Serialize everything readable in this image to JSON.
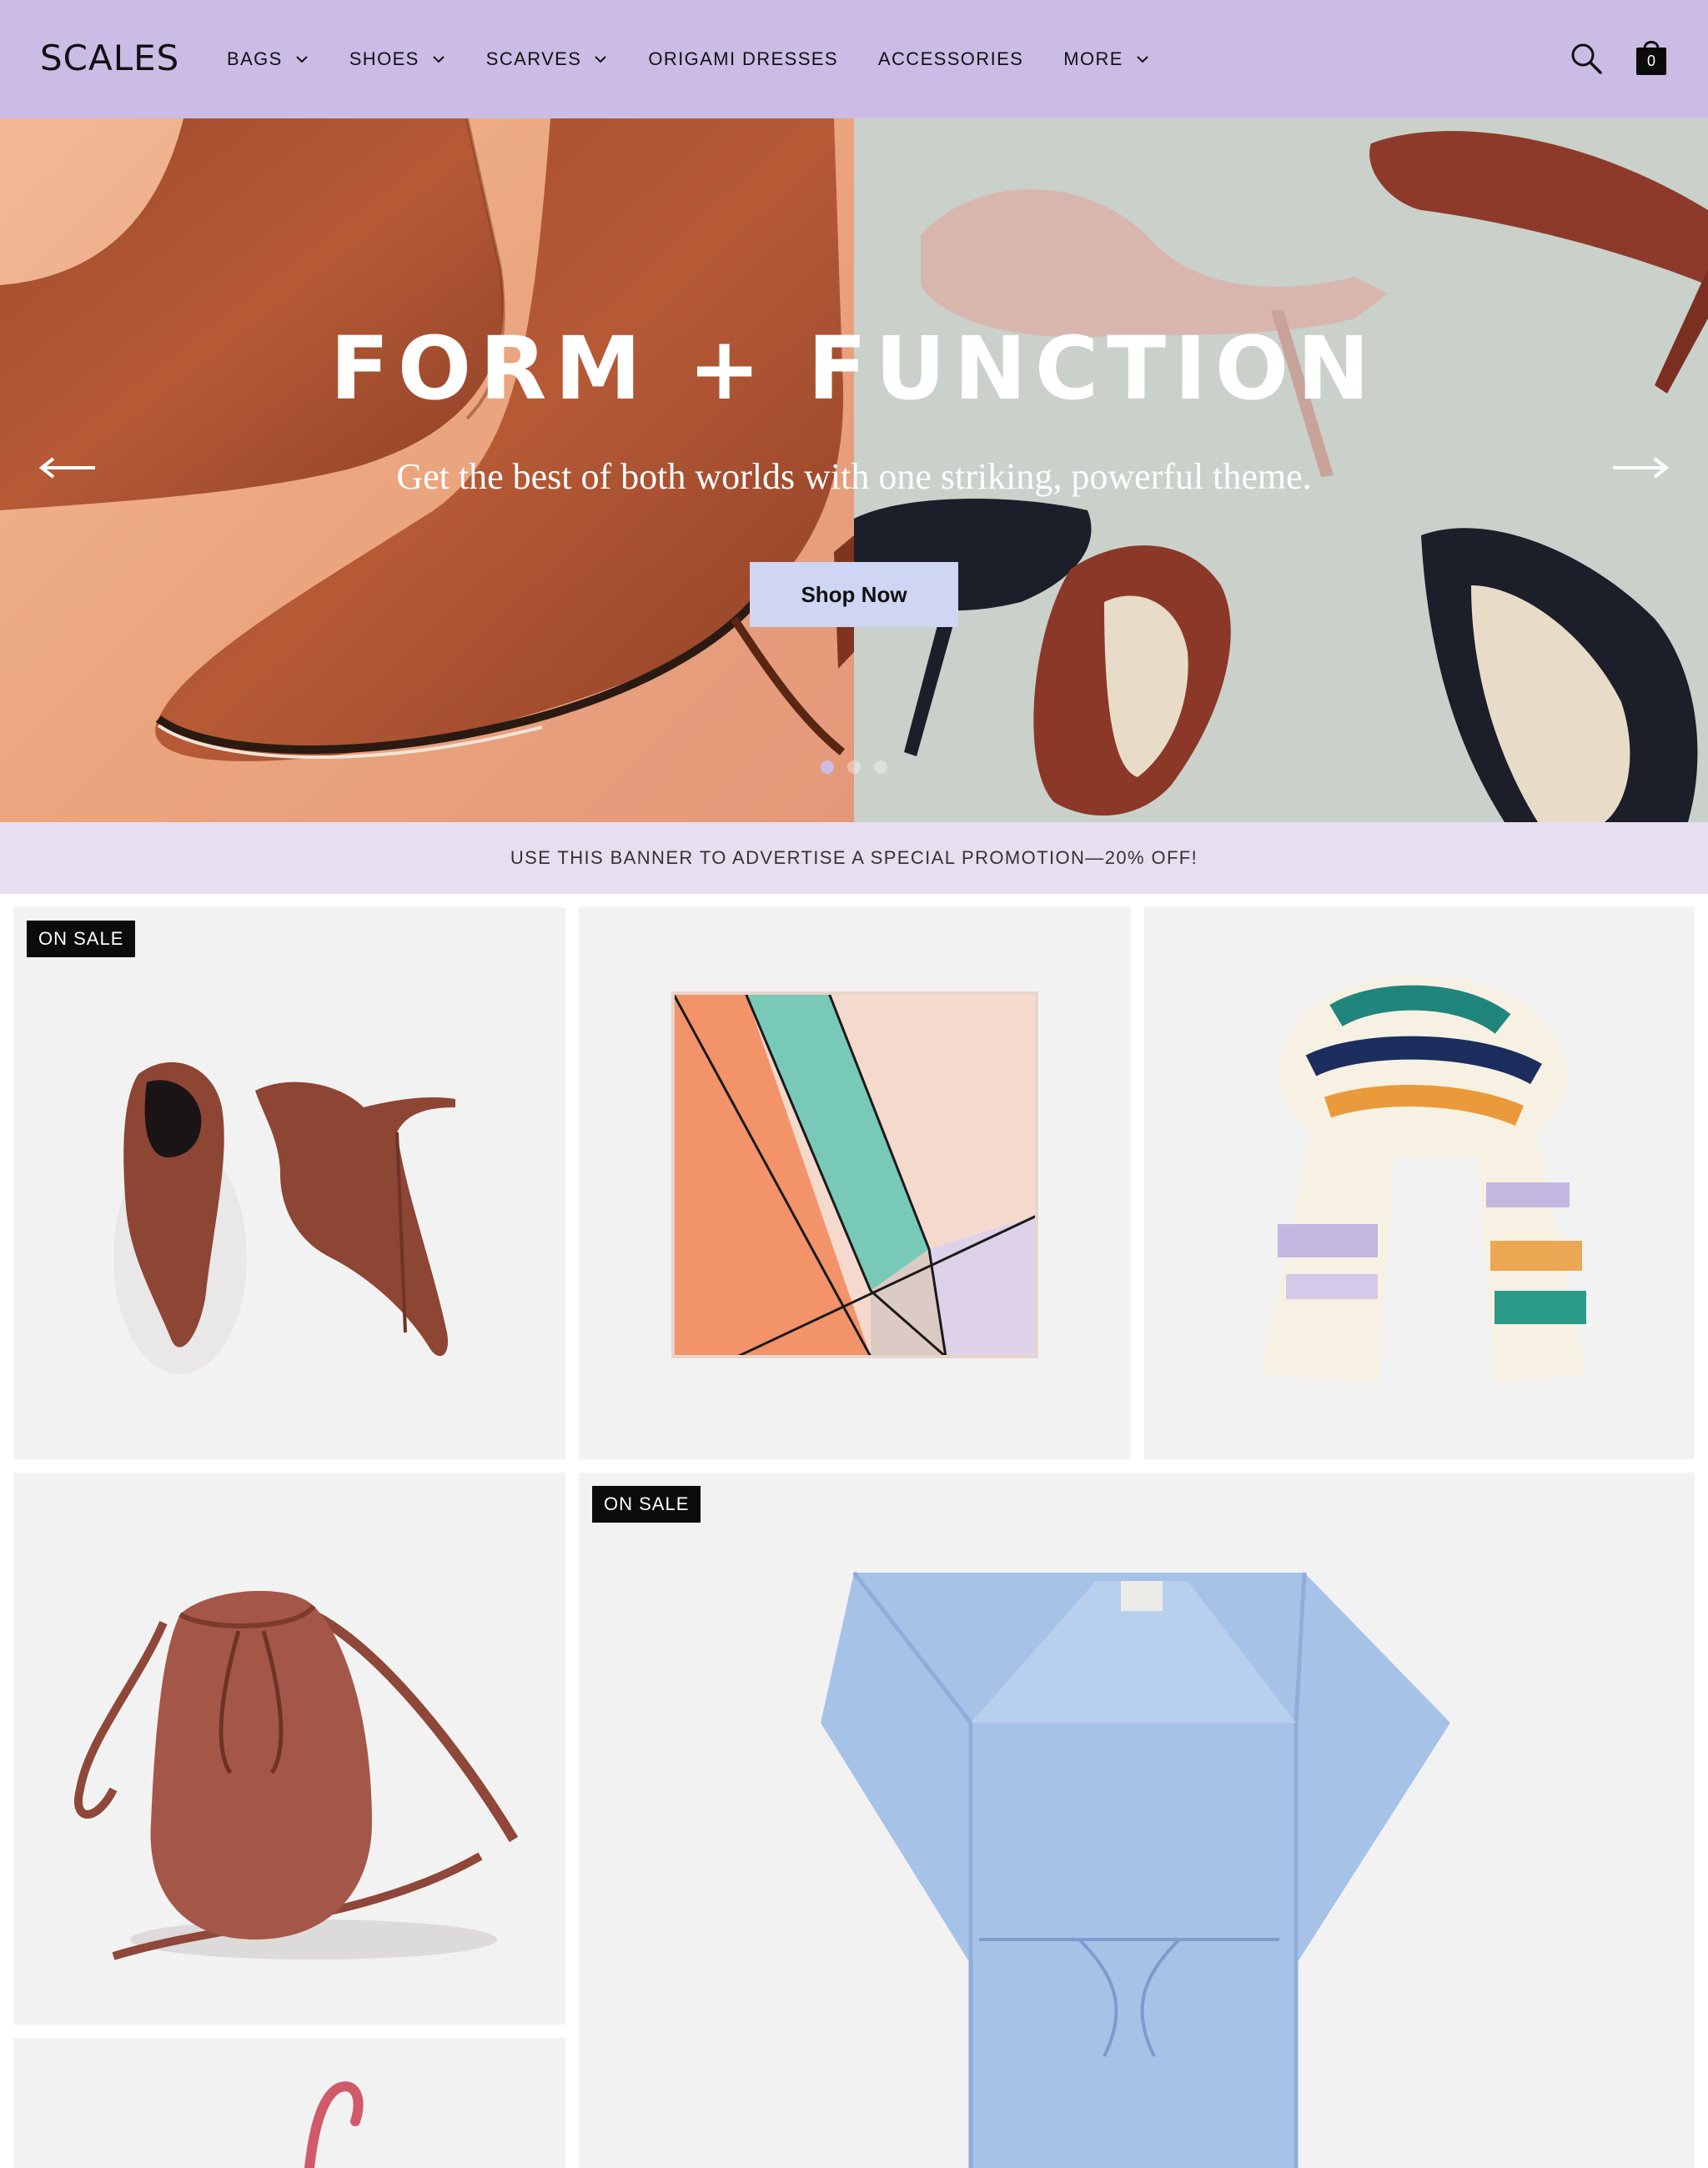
{
  "header": {
    "logo": "SCALES",
    "nav": [
      {
        "label": "BAGS",
        "has_dropdown": true
      },
      {
        "label": "SHOES",
        "has_dropdown": true
      },
      {
        "label": "SCARVES",
        "has_dropdown": true
      },
      {
        "label": "ORIGAMI DRESSES",
        "has_dropdown": false
      },
      {
        "label": "ACCESSORIES",
        "has_dropdown": false
      },
      {
        "label": "MORE",
        "has_dropdown": true
      }
    ],
    "search_icon": "search-icon",
    "cart_icon": "shopping-bag-icon",
    "cart_count": "0"
  },
  "hero": {
    "title": "FORM + FUNCTION",
    "subtitle": "Get the best of both worlds with one striking, powerful theme.",
    "cta_label": "Shop Now",
    "prev_icon": "arrow-left-icon",
    "next_icon": "arrow-right-icon",
    "slides": 3,
    "active_slide": 1
  },
  "promo": {
    "text": "USE THIS BANNER TO ADVERTISE A SPECIAL PROMOTION—20% OFF!"
  },
  "products": [
    {
      "item": "suede ankle booties",
      "badge": "ON SALE"
    },
    {
      "item": "geometric silk scarf",
      "badge": ""
    },
    {
      "item": "watercolor stripe scarf",
      "badge": ""
    },
    {
      "item": "leather bucket bag",
      "badge": ""
    },
    {
      "item": "blue origami dress",
      "badge": "ON SALE"
    },
    {
      "item": "pink wristlet",
      "badge": ""
    }
  ],
  "colors": {
    "header_bg": "#cbbce6",
    "promo_bg": "#e7dff0",
    "cta_bg": "#cfd6f4",
    "card_bg": "#f3f2f3",
    "badge_bg": "#0b0b0b"
  }
}
